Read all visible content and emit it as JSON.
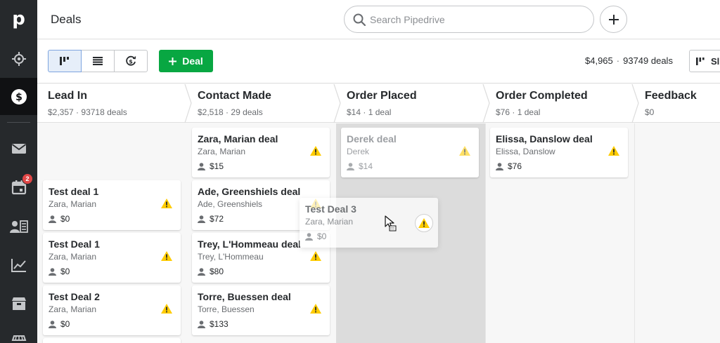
{
  "app": {
    "logo_letter": "p",
    "page_title": "Deals"
  },
  "sidebar": {
    "items": [
      {
        "name": "focus",
        "icon": "target-icon"
      },
      {
        "name": "deals",
        "icon": "dollar-circle-icon",
        "active": true
      },
      {
        "name": "mail",
        "icon": "mail-icon"
      },
      {
        "name": "activities",
        "icon": "calendar-icon",
        "badge": "2"
      },
      {
        "name": "contacts",
        "icon": "contacts-icon"
      },
      {
        "name": "insights",
        "icon": "trend-chart-icon"
      },
      {
        "name": "products",
        "icon": "box-icon"
      },
      {
        "name": "marketplace",
        "icon": "store-icon"
      }
    ]
  },
  "header": {
    "search_placeholder": "Search Pipedrive",
    "add_icon": "plus-icon"
  },
  "toolbar": {
    "views": [
      "pipeline-view",
      "list-view",
      "forecast-view"
    ],
    "active_view": "pipeline-view",
    "deal_button_label": "Deal",
    "total_value": "$4,965",
    "separator": "·",
    "total_deals": "93749 deals",
    "pipeline_button_label": "Sl"
  },
  "stages": [
    {
      "name": "Lead In",
      "value": "$2,357",
      "count": "93718 deals"
    },
    {
      "name": "Contact Made",
      "value": "$2,518",
      "count": "29 deals"
    },
    {
      "name": "Order Placed",
      "value": "$14",
      "count": "1 deal"
    },
    {
      "name": "Order Completed",
      "value": "$76",
      "count": "1 deal"
    },
    {
      "name": "Feedback",
      "value": "$0",
      "count": ""
    }
  ],
  "meta_separator": "·",
  "columns": [
    {
      "cards": [
        {
          "title": "Test deal 1",
          "contact": "Zara, Marian",
          "value": "$0"
        },
        {
          "title": "Test Deal 1",
          "contact": "Zara, Marian",
          "value": "$0"
        },
        {
          "title": "Test Deal 2",
          "contact": "Zara, Marian",
          "value": "$0"
        }
      ]
    },
    {
      "cards": [
        {
          "title": "Zara, Marian deal",
          "contact": "Zara, Marian",
          "value": "$15"
        },
        {
          "title": "Ade, Greenshiels deal",
          "contact": "Ade, Greenshiels",
          "value": "$72"
        },
        {
          "title": "Trey, L'Hommeau deal",
          "contact": "Trey, L'Hommeau",
          "value": "$80"
        },
        {
          "title": "Torre, Buessen deal",
          "contact": "Torre, Buessen",
          "value": "$133"
        }
      ]
    },
    {
      "cards": [
        {
          "title": "Derek deal",
          "contact": "Derek",
          "value": "$14",
          "faded": true
        }
      ]
    },
    {
      "cards": [
        {
          "title": "Elissa, Danslow deal",
          "contact": "Elissa, Danslow",
          "value": "$76"
        }
      ]
    },
    {
      "cards": []
    }
  ],
  "dragging_card": {
    "title": "Test Deal 3",
    "contact": "Zara, Marian",
    "value": "$0"
  },
  "colors": {
    "sidebar_bg": "#26292c",
    "accent_green": "#08a742",
    "warning_yellow": "#ffcc00",
    "drop_zone": "#dcdcdc"
  }
}
